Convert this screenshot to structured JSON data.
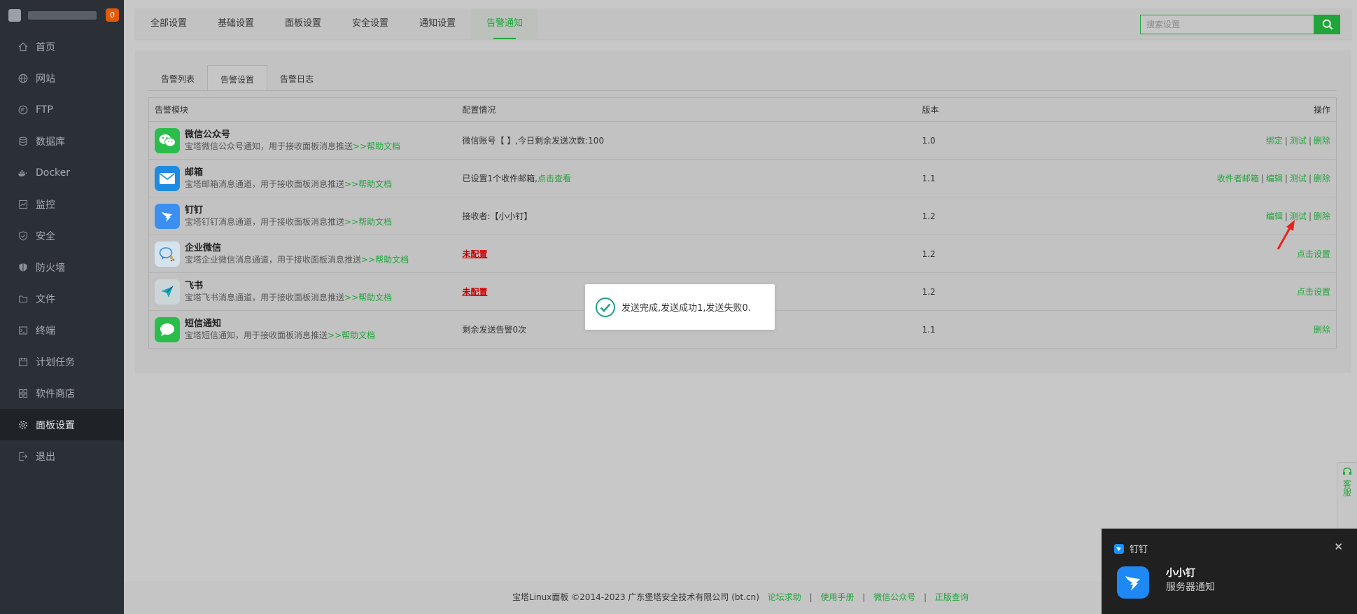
{
  "sidebar": {
    "badge": "0",
    "items": [
      {
        "label": "首页",
        "icon": "home-icon"
      },
      {
        "label": "网站",
        "icon": "globe-icon"
      },
      {
        "label": "FTP",
        "icon": "ftp-icon"
      },
      {
        "label": "数据库",
        "icon": "database-icon"
      },
      {
        "label": "Docker",
        "icon": "docker-icon"
      },
      {
        "label": "监控",
        "icon": "monitor-icon"
      },
      {
        "label": "安全",
        "icon": "shield-icon"
      },
      {
        "label": "防火墙",
        "icon": "firewall-icon"
      },
      {
        "label": "文件",
        "icon": "folder-icon"
      },
      {
        "label": "终端",
        "icon": "terminal-icon"
      },
      {
        "label": "计划任务",
        "icon": "calendar-icon"
      },
      {
        "label": "软件商店",
        "icon": "store-icon"
      },
      {
        "label": "面板设置",
        "icon": "gear-icon"
      },
      {
        "label": "退出",
        "icon": "logout-icon"
      }
    ]
  },
  "topbar": {
    "tabs": [
      "全部设置",
      "基础设置",
      "面板设置",
      "安全设置",
      "通知设置",
      "告警通知"
    ],
    "search_placeholder": "搜索设置"
  },
  "subtabs": [
    "告警列表",
    "告警设置",
    "告警日志"
  ],
  "table": {
    "headers": [
      "告警模块",
      "配置情况",
      "版本",
      "操作"
    ],
    "rows": [
      {
        "name": "微信公众号",
        "desc": "宝塔微信公众号通知，用于接收面板消息推送",
        "help": ">>帮助文档",
        "config": "微信账号【    】,今日剩余发送次数:100",
        "version": "1.0",
        "actions": [
          "绑定",
          "测试",
          "删除"
        ]
      },
      {
        "name": "邮箱",
        "desc": "宝塔邮箱消息通道，用于接收面板消息推送",
        "help": ">>帮助文档",
        "config": "已设置1个收件邮箱,",
        "config_link": "点击查看",
        "version": "1.1",
        "actions": [
          "收件者邮箱",
          "编辑",
          "测试",
          "删除"
        ]
      },
      {
        "name": "钉钉",
        "desc": "宝塔钉钉消息通道，用于接收面板消息推送",
        "help": ">>帮助文档",
        "config": "接收者:【小小钉】",
        "version": "1.2",
        "actions": [
          "编辑",
          "测试",
          "删除"
        ]
      },
      {
        "name": "企业微信",
        "desc": "宝塔企业微信消息通道，用于接收面板消息推送",
        "help": ">>帮助文档",
        "config_warn": "未配置",
        "version": "1.2",
        "actions": [
          "点击设置"
        ]
      },
      {
        "name": "飞书",
        "desc": "宝塔飞书消息通道，用于接收面板消息推送",
        "help": ">>帮助文档",
        "config_warn": "未配置",
        "version": "1.2",
        "actions": [
          "点击设置"
        ]
      },
      {
        "name": "短信通知",
        "desc": "宝塔短信通知，用于接收面板消息推送",
        "help": ">>帮助文档",
        "config": "剩余发送告警0次",
        "version": "1.1",
        "actions": [
          "删除"
        ]
      }
    ]
  },
  "toast": {
    "text": "发送完成,发送成功1,发送失败0."
  },
  "footer": {
    "copyright": "宝塔Linux面板 ©2014-2023 广东堡塔安全技术有限公司 (bt.cn)",
    "links": [
      "论坛求助",
      "使用手册",
      "微信公众号",
      "正版查询"
    ]
  },
  "float_service": {
    "label": "客服"
  },
  "notification": {
    "app": "钉钉",
    "title": "小小钉",
    "body": "服务器通知"
  },
  "colors": {
    "accent": "#20a53a",
    "warn": "#cc0000",
    "sidebar_bg": "#2b3036"
  }
}
